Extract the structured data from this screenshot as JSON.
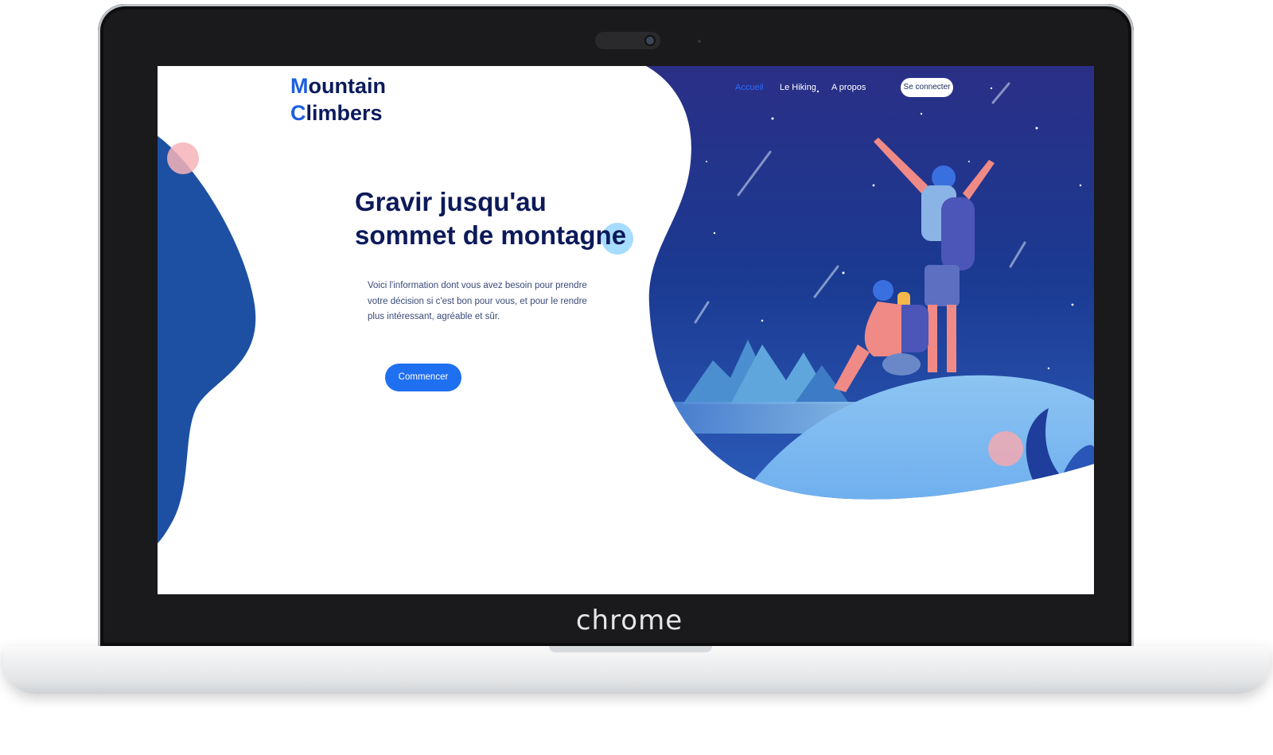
{
  "device": {
    "brand_label": "chrome"
  },
  "site": {
    "logo": {
      "line1_initial": "M",
      "line1_rest": "ountain",
      "line2_initial": "C",
      "line2_rest": "limbers"
    },
    "nav": {
      "items": [
        "Accueil",
        "Le Hiking",
        "A propos"
      ],
      "active_index": 0,
      "login_label": "Se connecter"
    },
    "hero": {
      "headline_line1": "Gravir jusqu'au",
      "headline_line2": "sommet de montagne",
      "description": "Voici l'information dont vous avez besoin pour prendre votre décision si c'est bon pour vous, et pour le rendre plus intéressant, agréable et sûr.",
      "cta_label": "Commencer"
    }
  },
  "colors": {
    "accent_blue": "#1f6ff1",
    "heading_navy": "#0c1a5a",
    "night_sky": "#1b2f86",
    "blob_blue": "#1d50a3"
  },
  "icons": {
    "illustration": "hikers-night-sky-illustration"
  }
}
